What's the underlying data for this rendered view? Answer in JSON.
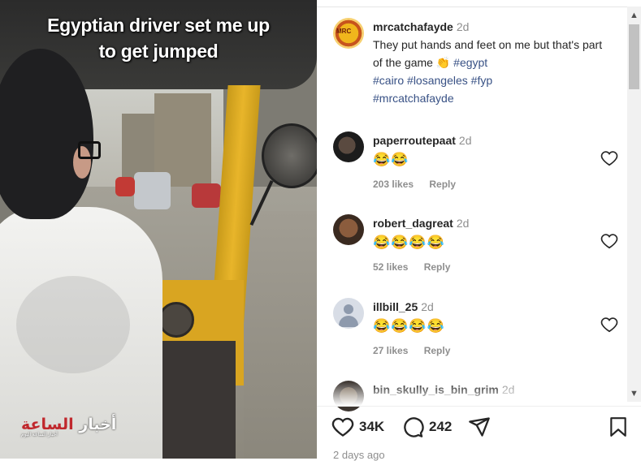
{
  "video": {
    "caption_line1": "Egyptian driver set me up",
    "caption_line2": "to get jumped",
    "watermark": {
      "main_red": "الساعة",
      "main_white": "أخبار",
      "sub": "أخبار الساعة اليوم"
    }
  },
  "post": {
    "author": "mrcatchafayde",
    "time": "2d",
    "avatar_text": "MRC",
    "caption_text": "They put hands and feet on me but that's part of the game",
    "caption_emoji": "👏",
    "hashtags": [
      "#egypt",
      "#cairo",
      "#losangeles",
      "#fyp",
      "#mrcatchafayde"
    ]
  },
  "comments": [
    {
      "user": "paperroutepaat",
      "time": "2d",
      "text": "😂😂",
      "likes": "203 likes",
      "reply": "Reply",
      "avatar": "dark"
    },
    {
      "user": "robert_dagreat",
      "time": "2d",
      "text": "😂😂😂😂",
      "likes": "52 likes",
      "reply": "Reply",
      "avatar": "brown"
    },
    {
      "user": "illbill_25",
      "time": "2d",
      "text": "😂😂😂😂",
      "likes": "27 likes",
      "reply": "Reply",
      "avatar": "default"
    },
    {
      "user": "bin_skully_is_bin_grim",
      "time": "2d",
      "avatar": "grim"
    }
  ],
  "actions": {
    "like_count": "34K",
    "comment_count": "242",
    "icons": [
      "heart-icon",
      "comment-icon",
      "share-icon",
      "save-icon"
    ]
  },
  "post_age": "2 days ago",
  "colors": {
    "link": "#385185",
    "muted": "#8e8e8e",
    "text": "#262626",
    "accent_yellow": "#e8b52a"
  }
}
